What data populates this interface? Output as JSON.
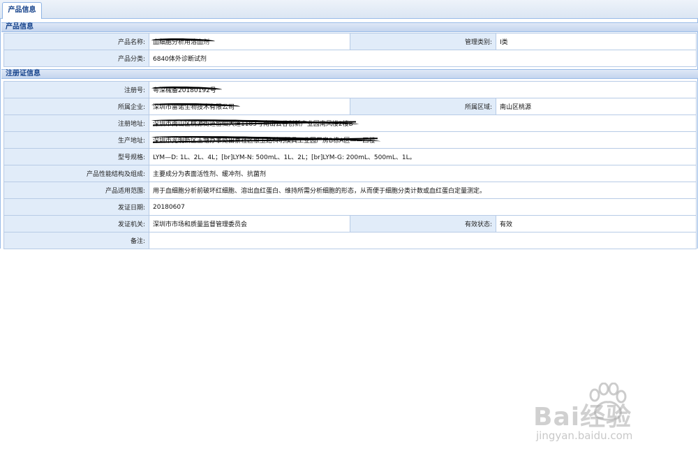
{
  "tab": {
    "label": "产品信息"
  },
  "product_section": {
    "title": "产品信息",
    "name_label": "产品名称:",
    "name_value": "血细胞分析用溶血剂",
    "mgmt_class_label": "管理类别:",
    "mgmt_class_value": "Ⅰ类",
    "category_label": "产品分类:",
    "category_value": "6840体外诊断试剂"
  },
  "registration_section": {
    "title": "注册证信息",
    "reg_no_label": "注册号:",
    "reg_no_value": "粤深械备20180192号",
    "company_label": "所属企业:",
    "company_value": "深圳市雷诺生物技术有限公司",
    "region_label": "所属区域:",
    "region_value": "南山区桃源",
    "reg_address_label": "注册地址:",
    "reg_address_value": "深圳市南山区桃源街道留仙大道1183号南山云谷创新产业园南风楼2楼B",
    "prod_address_label": "生产地址:",
    "prod_address_value": "深圳市光明新区玉塘办事处田寮社区根玉路科明模具工业园厂房B栋A区——四楼",
    "spec_label": "型号规格:",
    "spec_value": "LYM—D: 1L、2L、4L；[br]LYM-N: 500mL、1L、2L；[br]LYM-G: 200mL、500mL、1L。",
    "composition_label": "产品性能结构及组成:",
    "composition_value": "主要成分为表面活性剂、缓冲剂、抗菌剂",
    "scope_label": "产品适用范围:",
    "scope_value": "用于血细胞分析前破坏红细胞、溶出血红蛋白、维持所需分析细胞的形态，从而便于细胞分类计数或血红蛋白定量测定。",
    "issue_date_label": "发证日期:",
    "issue_date_value": "20180607",
    "authority_label": "发证机关:",
    "authority_value": "深圳市市场和质量监督管理委员会",
    "status_label": "有效状态:",
    "status_value": "有效",
    "remarks_label": "备注:",
    "remarks_value": ""
  },
  "watermark": {
    "logo_text": "Bai经验",
    "url": "jingyan.baidu.com"
  }
}
